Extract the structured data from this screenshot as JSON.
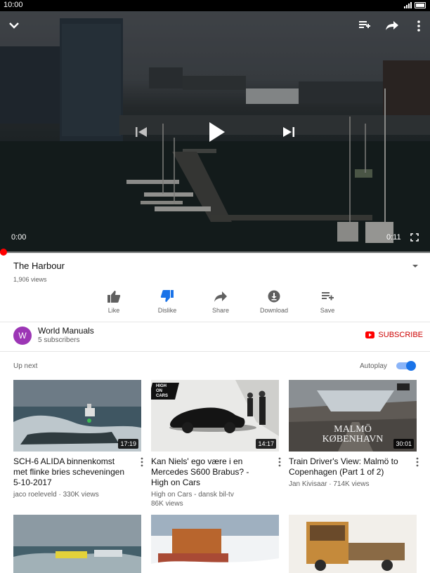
{
  "status_bar": {
    "time": "10:00"
  },
  "player": {
    "current_time": "0:00",
    "duration": "0:11",
    "progress": 0.0,
    "icons": [
      "chevron-down-icon",
      "add-to-queue-icon",
      "share-icon",
      "more-vert-icon",
      "skip-previous-icon",
      "play-icon",
      "skip-next-icon",
      "fullscreen-icon"
    ]
  },
  "video": {
    "title": "The Harbour",
    "views": "1,906 views"
  },
  "actions": [
    {
      "label": "Like",
      "icon": "thumb-up-icon"
    },
    {
      "label": "Dislike",
      "icon": "thumb-down-icon",
      "active_color": "#1a73e8"
    },
    {
      "label": "Share",
      "icon": "share-icon"
    },
    {
      "label": "Download",
      "icon": "download-icon"
    },
    {
      "label": "Save",
      "icon": "playlist-add-icon"
    }
  ],
  "channel": {
    "avatar_letter": "W",
    "name": "World Manuals",
    "subscribers": "5 subscribers",
    "subscribe_label": "SUBSCRIBE",
    "avatar_color": "#9c36b5"
  },
  "up_next": {
    "label": "Up next",
    "autoplay_label": "Autoplay",
    "autoplay_on": true,
    "videos": [
      {
        "title": "SCH-6 ALIDA binnenkomst met flinke bries scheveningen 5-10-2017",
        "meta1": "jaco roeleveld · 330K views",
        "meta2": "",
        "duration": "17:19"
      },
      {
        "title": "Kan Niels' ego være i en Mercedes S600 Brabus? - High on Cars",
        "meta1": "High on Cars - dansk bil-tv",
        "meta2": "86K views",
        "duration": "14:17",
        "thumb_text": [
          "HIGH",
          "ON",
          "CARS"
        ]
      },
      {
        "title": "Train Driver's View: Malmö to Copenhagen (Part 1 of 2)",
        "meta1": "Jan Kivisaar · 714K views",
        "meta2": "",
        "duration": "30:01",
        "thumb_text": [
          "MALMÖ",
          "KØBENHAVN"
        ]
      }
    ]
  },
  "colors": {
    "accent_red": "#ff0000",
    "subscribe_red": "#cc0000",
    "toggle_blue": "#1a73e8"
  }
}
